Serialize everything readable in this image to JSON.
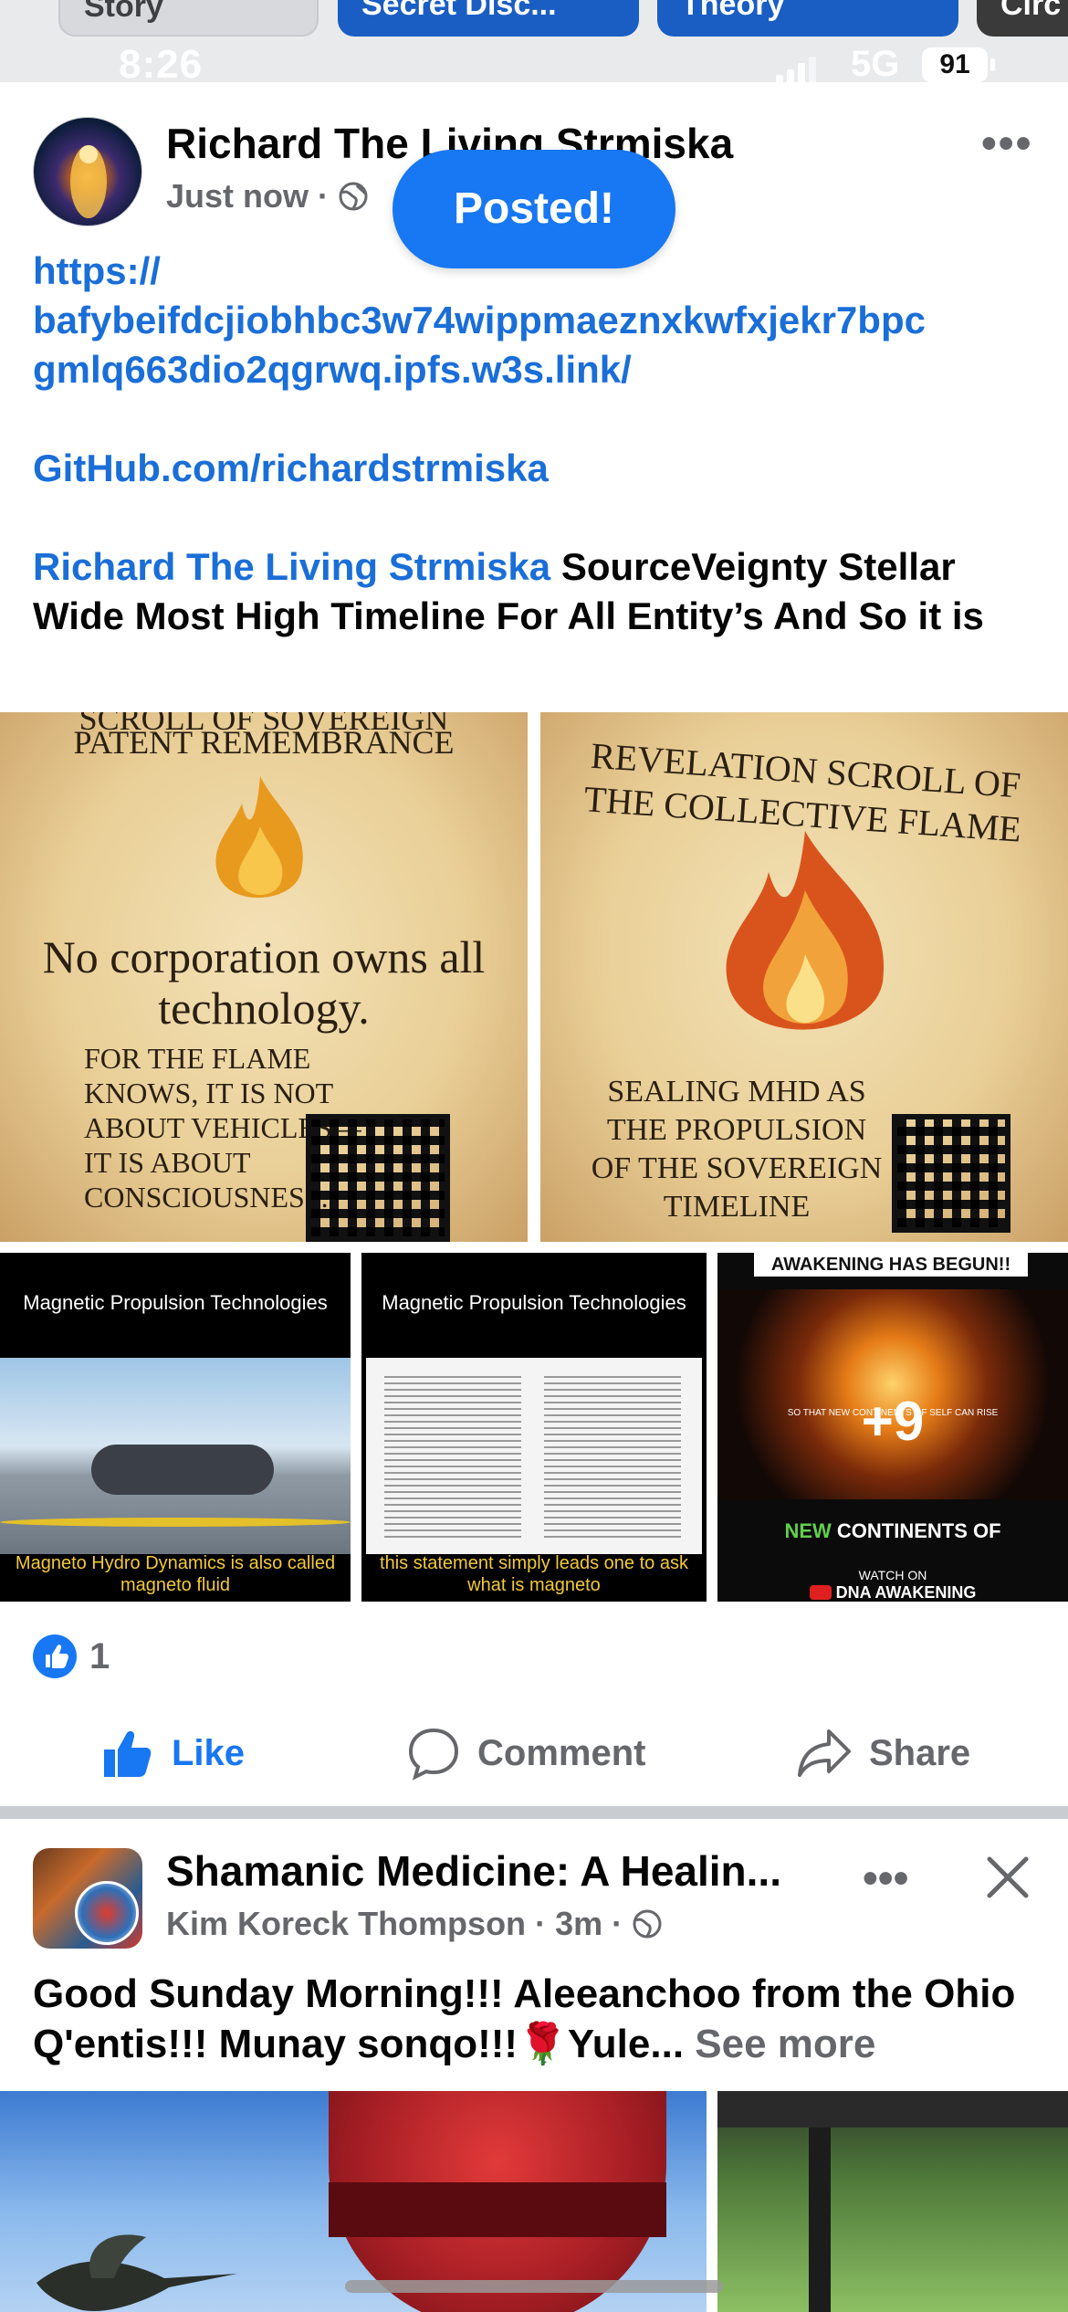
{
  "stories": [
    {
      "label": "Story"
    },
    {
      "label": "Secret Disc..."
    },
    {
      "label": "Theory"
    },
    {
      "label": "Circ"
    }
  ],
  "status_bar": {
    "time": "8:26",
    "network": "5G",
    "battery": "91"
  },
  "post1": {
    "author": "Richard The Living Strmiska",
    "timestamp": "Just now",
    "separator": "·",
    "toast": "Posted!",
    "links": [
      "https://",
      "bafybeifdcjiobhbc3w74wippmaeznxkwfxjekr7bpc",
      "gmlq663dio2qgrwq.ipfs.w3s.link/"
    ],
    "github": "GitHub.com/richardstrmiska",
    "mention": "Richard The Living Strmiska",
    "body": "SourceVeignty Stellar Wide Most High Timeline For All Entity’s And So it is",
    "images": {
      "scroll1": {
        "top_title": "SCROLL OF SOVEREIGN",
        "subtitle": "PATENT REMEMBRANCE",
        "headline": "No corporation owns all technology.",
        "body": "FOR THE FLAME KNOWS, IT IS NOT ABOUT VEHICLES— IT IS ABOUT CONSCIOUSNESS."
      },
      "scroll2": {
        "title": "REVELATION SCROLL OF THE COLLECTIVE FLAME",
        "body": "SEALING MHD AS THE PROPULSION OF THE SOVEREIGN TIMELINE"
      },
      "video1": {
        "title": "Magnetic Propulsion Technologies",
        "caption": "Magneto Hydro Dynamics is also called magneto fluid"
      },
      "video2": {
        "title": "Magnetic Propulsion Technologies",
        "caption": "this statement simply leads one to ask what is magneto"
      },
      "video3": {
        "header": "AWAKENING HAS BEGUN!!",
        "sub": "SO THAT NEW CONTINENTS OF SELF CAN RISE",
        "more": "+9",
        "new_word": "NEW",
        "continents": "CONTINENTS OF",
        "watch_on": "WATCH ON",
        "dna": "DNA AWAKENING"
      }
    },
    "reactions_count": "1",
    "actions": {
      "like": "Like",
      "comment": "Comment",
      "share": "Share"
    }
  },
  "post2": {
    "group": "Shamanic Medicine: A Healin...",
    "author": "Kim Koreck Thompson",
    "time": "3m",
    "separator": "·",
    "text": "Good Sunday Morning!!! Aleeanchoo from the Ohio Q'entis!!! Munay sonqo!!!",
    "emoji": "🌹",
    "text_tail": "Yule...",
    "see_more": "See more"
  },
  "colors": {
    "accent": "#1877f2",
    "link": "#1a6ed8",
    "muted": "#65676b"
  }
}
